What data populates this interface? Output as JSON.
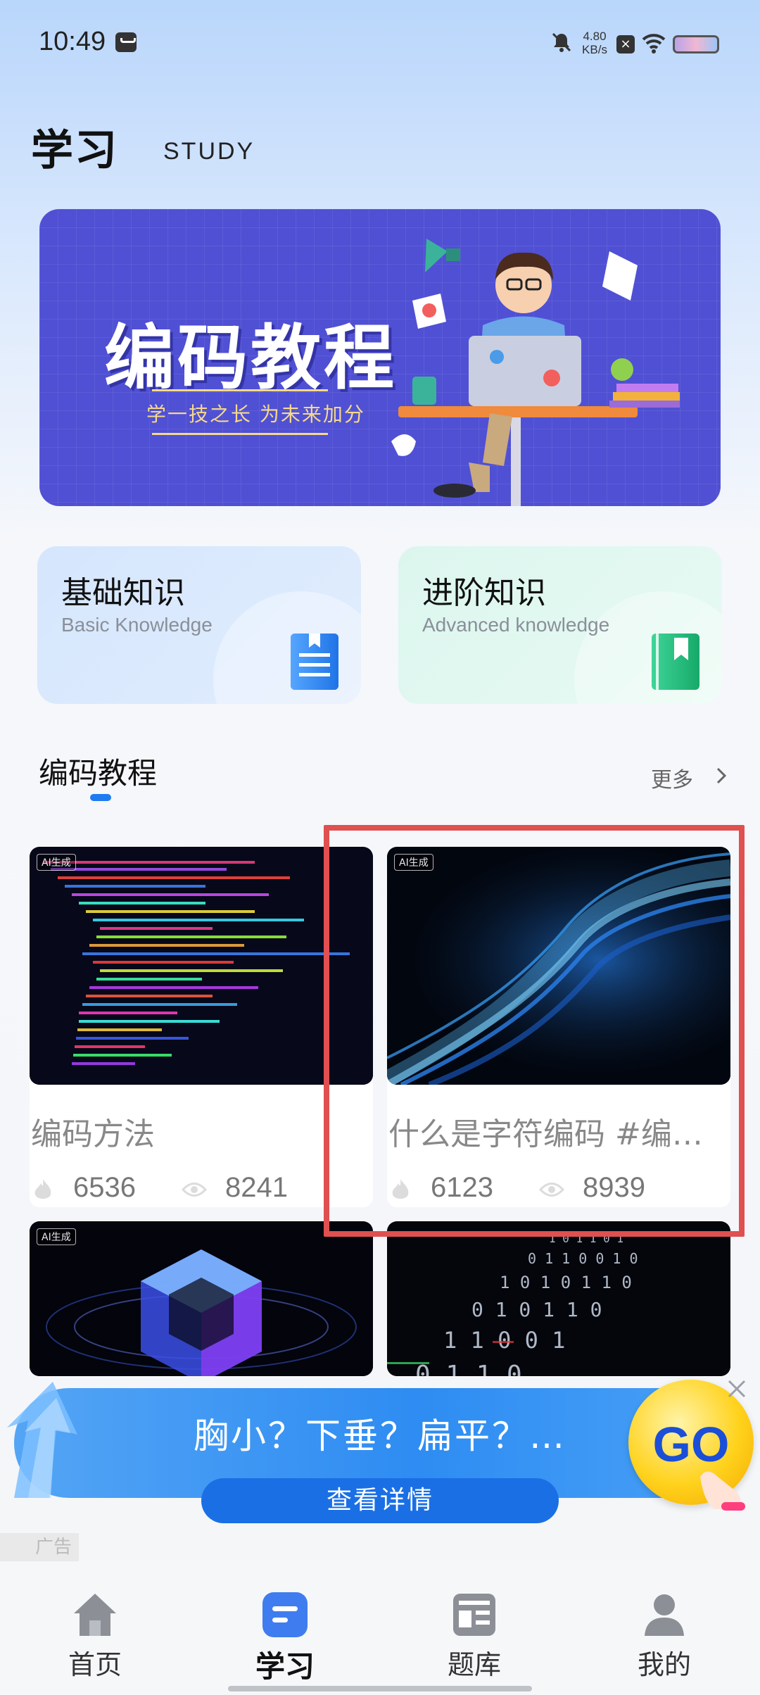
{
  "status_bar": {
    "time": "10:49",
    "net_speed": "4.80\nKB/s",
    "icons": [
      "message-icon",
      "bell-muted-icon",
      "close-box-icon",
      "wifi-icon",
      "battery-icon"
    ]
  },
  "header": {
    "title": "学习",
    "subtitle": "STUDY"
  },
  "banner": {
    "title": "编码教程",
    "subtitle": "学一技之长 为未来加分"
  },
  "knowledge_cards": [
    {
      "title": "基础知识",
      "subtitle": "Basic Knowledge",
      "icon": "book-blue-icon",
      "color": "#2e86f2"
    },
    {
      "title": "进阶知识",
      "subtitle": "Advanced knowledge",
      "icon": "book-green-icon",
      "color": "#22c07f"
    }
  ],
  "section": {
    "title": "编码教程",
    "more": "更多"
  },
  "videos": [
    {
      "tag": "AI生成",
      "title": "编码方法",
      "hot": "6536",
      "views": "8241"
    },
    {
      "tag": "AI生成",
      "title": "什么是字符编码 #编…",
      "hot": "6123",
      "views": "8939"
    },
    {
      "tag": "AI生成",
      "title": "",
      "hot": "",
      "views": ""
    },
    {
      "tag": "",
      "title": "",
      "hot": "",
      "views": ""
    }
  ],
  "ad": {
    "text": "胸小？下垂？扁平？…",
    "button": "查看详情",
    "go": "GO",
    "label": "广告"
  },
  "nav": [
    {
      "label": "首页",
      "icon": "home-icon",
      "active": false
    },
    {
      "label": "学习",
      "icon": "study-icon",
      "active": true
    },
    {
      "label": "题库",
      "icon": "question-bank-icon",
      "active": false
    },
    {
      "label": "我的",
      "icon": "profile-icon",
      "active": false
    }
  ],
  "colors": {
    "accent": "#1f7bf0",
    "banner_bg": "#5050d4",
    "highlight_box": "#e05050"
  }
}
